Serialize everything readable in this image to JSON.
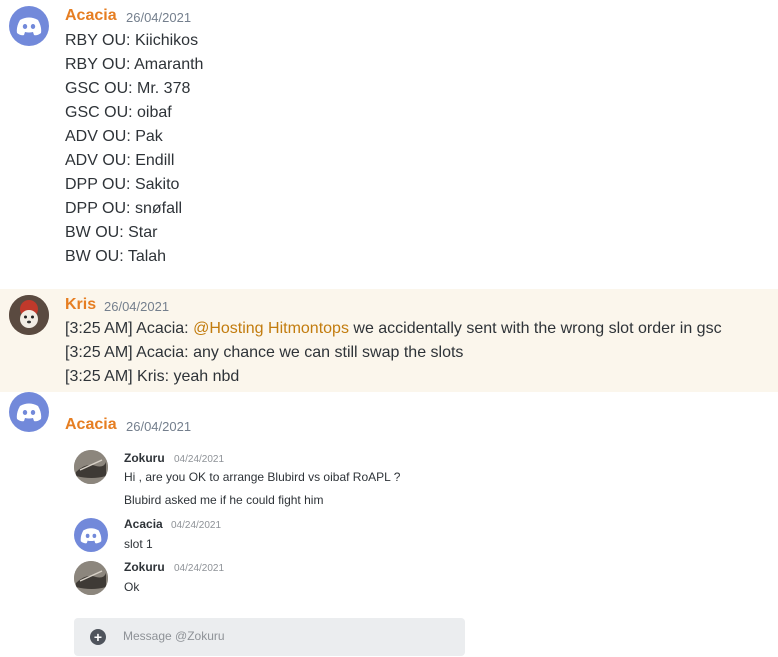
{
  "messages": [
    {
      "author": "Acacia",
      "timestamp": "26/04/2021",
      "lines": [
        "RBY OU: Kiichikos",
        "RBY OU: Amaranth",
        "GSC OU: Mr. 378",
        "GSC OU: oibaf",
        "ADV OU: Pak",
        "ADV OU: Endill",
        "DPP OU: Sakito",
        "DPP OU: snøfall",
        "BW OU: Star",
        "BW OU: Talah"
      ]
    },
    {
      "author": "Kris",
      "timestamp": "26/04/2021",
      "line1_prefix": "[3:25 AM] Acacia: ",
      "line1_mention": "@Hosting Hitmontops",
      "line1_suffix": " we accidentally sent with the wrong slot order in gsc",
      "line2": "[3:25 AM] Acacia: any chance we can still swap the slots",
      "line3": "[3:25 AM] Kris: yeah nbd"
    },
    {
      "author": "Acacia",
      "timestamp": "26/04/2021"
    }
  ],
  "embedded": [
    {
      "author": "Zokuru",
      "timestamp": "04/24/2021",
      "lines": [
        "Hi , are you OK to arrange Blubird vs oibaf RoAPL ?",
        "Blubird asked me if he could fight him"
      ]
    },
    {
      "author": "Acacia",
      "timestamp": "04/24/2021",
      "lines": [
        "slot 1"
      ]
    },
    {
      "author": "Zokuru",
      "timestamp": "04/24/2021",
      "lines": [
        "Ok"
      ]
    }
  ],
  "input": {
    "placeholder": "Message @Zokuru"
  },
  "colors": {
    "author": "#e67e22",
    "mention": "#c27c0e",
    "highlight_bg": "#fbf6ec",
    "discord_blurple": "#7289da"
  },
  "icons": {
    "discord_avatar": "discord-logo-icon",
    "add": "plus-circle-icon"
  }
}
